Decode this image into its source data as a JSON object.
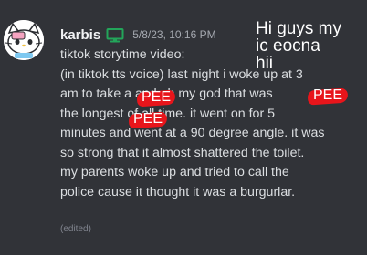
{
  "message": {
    "username": "karbis",
    "username_color": "#f2f3f5",
    "device_icon": "monitor-icon",
    "device_icon_color": "#23a55a",
    "timestamp": "5/8/23, 10:16 PM",
    "lines": [
      "tiktok storytime video:",
      "(in tiktok tts voice) last night i woke up at 3",
      "am to take a     and oh my god that     was",
      "the longest     of all time. it went on for 5",
      "minutes and went at a 90 degree angle. it was",
      "so strong that it almost shattered the toilet.",
      "my parents woke up and tried to call the",
      "police cause it thought it was a burgurlar."
    ],
    "edited_label": "(edited)"
  },
  "overlay": {
    "lines": [
      "Hi guys my",
      "ic eocna",
      "hii"
    ]
  },
  "stickers": [
    {
      "text": "PEE",
      "color": "#e8151b"
    },
    {
      "text": "PEE",
      "color": "#e8151b"
    },
    {
      "text": "PEE",
      "color": "#e8151b"
    }
  ],
  "colors": {
    "background": "#313338",
    "message_text": "#dbdee1",
    "timestamp": "#a5a9b0"
  }
}
